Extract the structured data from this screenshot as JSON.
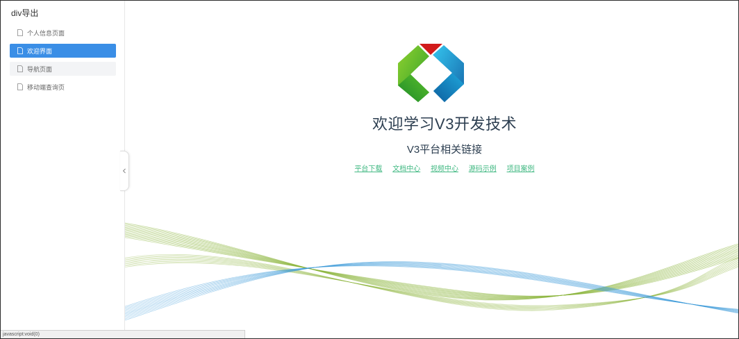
{
  "sidebar": {
    "title": "div导出",
    "items": [
      {
        "label": "个人信息页面",
        "state": "normal"
      },
      {
        "label": "欢迎界面",
        "state": "active"
      },
      {
        "label": "导航页面",
        "state": "hover"
      },
      {
        "label": "移动端查询页",
        "state": "normal"
      }
    ]
  },
  "main": {
    "welcome_title": "欢迎学习V3开发技术",
    "links_title": "V3平台相关链接",
    "links": [
      "平台下载",
      "文档中心",
      "视频中心",
      "源码示例",
      "项目案例"
    ]
  },
  "status_bar": {
    "text": "javascript:void(0)"
  },
  "colors": {
    "accent": "#3a8ee6",
    "link": "#42b983",
    "title": "#2c3e50",
    "wave_green": "#8bb43a",
    "wave_blue": "#3a9ad9"
  },
  "icons": {
    "nav": "document-icon",
    "collapse": "chevron-left-icon"
  }
}
